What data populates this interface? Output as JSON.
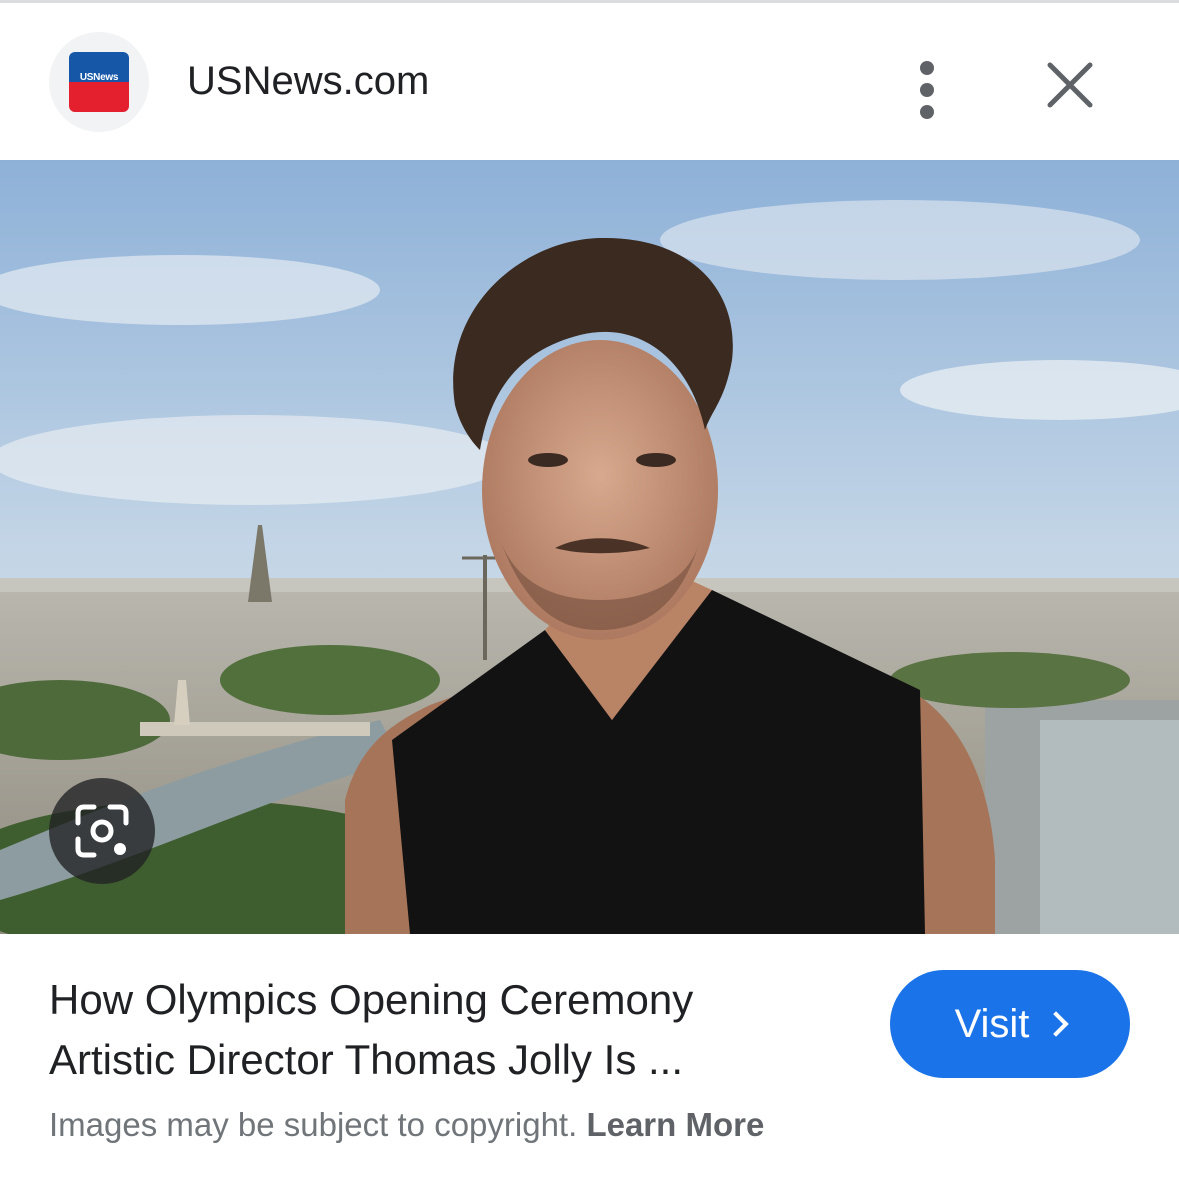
{
  "header": {
    "favicon_text": "USNews",
    "site_name": "USNews.com",
    "more_icon": "more-vert-icon",
    "close_icon": "close-icon"
  },
  "image": {
    "description_icon": "google-lens-icon"
  },
  "result": {
    "title_line1": "How Olympics Opening Ceremony",
    "title_line2": "Artistic Director Thomas Jolly Is ...",
    "visit_label": "Visit",
    "visit_icon": "chevron-right-icon"
  },
  "footer": {
    "copyright_text": "Images may be subject to copyright.",
    "learn_more": "Learn More"
  },
  "colors": {
    "accent": "#1a73e8",
    "brand_blue": "#1657a8",
    "brand_red": "#e4202e",
    "text_primary": "#202124",
    "text_secondary": "#70757a"
  }
}
